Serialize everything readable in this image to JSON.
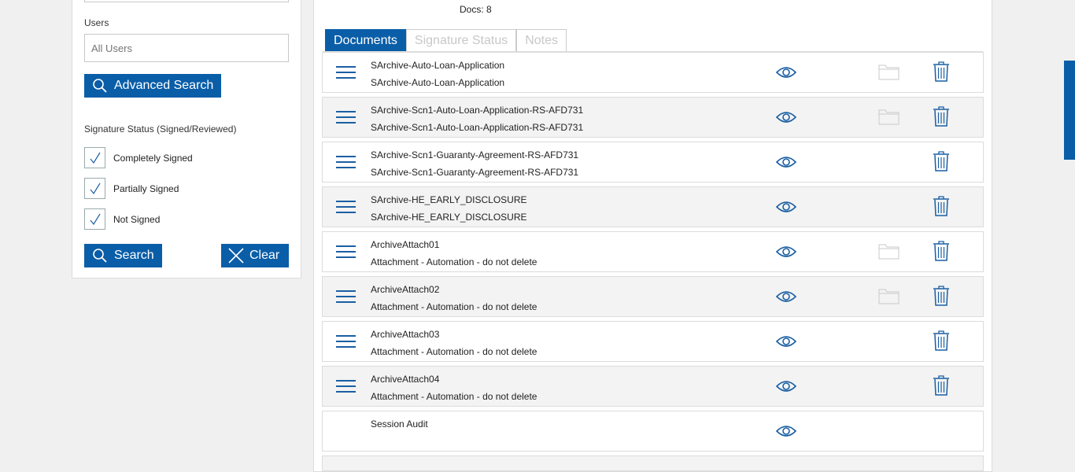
{
  "filters": {
    "users_label": "Users",
    "users_placeholder": "All Users",
    "advanced_search_label": "Advanced Search",
    "signature_status_label": "Signature Status (Signed/Reviewed)",
    "checkboxes": [
      {
        "label": "Completely Signed",
        "checked": true
      },
      {
        "label": "Partially Signed",
        "checked": true
      },
      {
        "label": "Not Signed",
        "checked": true
      }
    ],
    "search_label": "Search",
    "clear_label": "Clear"
  },
  "main": {
    "docs_count": "Docs: 8",
    "tabs": [
      {
        "label": "Documents",
        "active": true
      },
      {
        "label": "Signature Status",
        "active": false
      },
      {
        "label": "Notes",
        "active": false
      }
    ],
    "rows": [
      {
        "name1": "SArchive-Auto-Loan-Application",
        "name2": "SArchive-Auto-Loan-Application",
        "menu": true,
        "folder": true,
        "trash": true
      },
      {
        "name1": "SArchive-Scn1-Auto-Loan-Application-RS-AFD731",
        "name2": "SArchive-Scn1-Auto-Loan-Application-RS-AFD731",
        "menu": true,
        "folder": true,
        "trash": true
      },
      {
        "name1": "SArchive-Scn1-Guaranty-Agreement-RS-AFD731",
        "name2": "SArchive-Scn1-Guaranty-Agreement-RS-AFD731",
        "menu": true,
        "folder": false,
        "trash": true
      },
      {
        "name1": "SArchive-HE_EARLY_DISCLOSURE",
        "name2": "SArchive-HE_EARLY_DISCLOSURE",
        "menu": true,
        "folder": false,
        "trash": true
      },
      {
        "name1": "ArchiveAttach01",
        "name2": "Attachment - Automation - do not delete",
        "menu": true,
        "folder": true,
        "trash": true
      },
      {
        "name1": "ArchiveAttach02",
        "name2": "Attachment - Automation - do not delete",
        "menu": true,
        "folder": true,
        "trash": true
      },
      {
        "name1": "ArchiveAttach03",
        "name2": "Attachment - Automation - do not delete",
        "menu": true,
        "folder": false,
        "trash": true
      },
      {
        "name1": "ArchiveAttach04",
        "name2": "Attachment - Automation - do not delete",
        "menu": true,
        "folder": false,
        "trash": true
      },
      {
        "name1": "Session Audit",
        "name2": "",
        "menu": false,
        "folder": false,
        "trash": false
      }
    ]
  },
  "icons": {
    "menu": "hamburger-icon",
    "view": "eye-icon",
    "folder": "folder-icon",
    "delete": "trash-icon",
    "search": "search-icon",
    "clear": "close-icon",
    "check": "check-icon"
  },
  "colors": {
    "accent": "#0a5ea8",
    "icon_blue": "#1a5fa3",
    "folder_gray": "#c8c8c8"
  }
}
